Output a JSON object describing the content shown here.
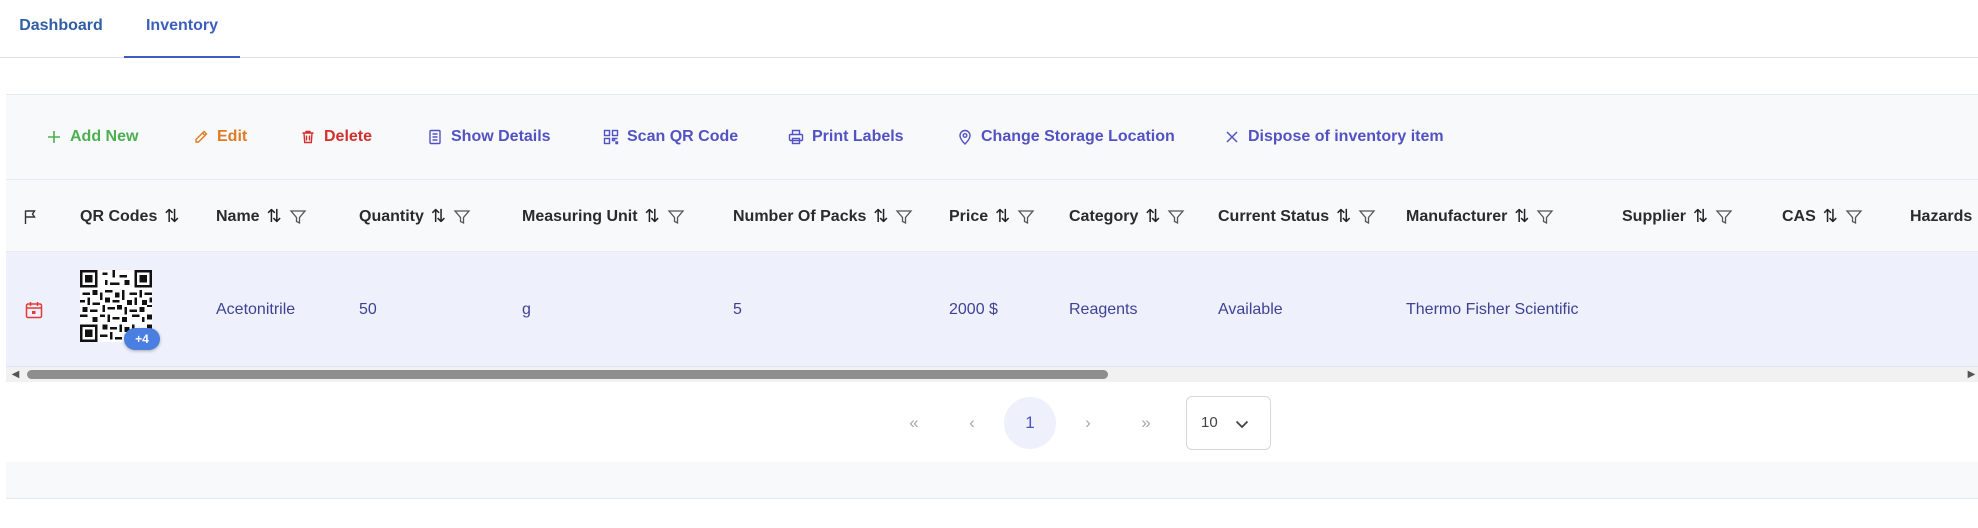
{
  "tabs": [
    {
      "label": "Dashboard"
    },
    {
      "label": "Inventory"
    }
  ],
  "toolbar": {
    "add_new": "Add New",
    "edit": "Edit",
    "delete": "Delete",
    "show_details": "Show Details",
    "scan_qr": "Scan QR Code",
    "print_labels": "Print Labels",
    "change_storage": "Change Storage Location",
    "dispose": "Dispose of inventory item"
  },
  "columns": {
    "qr_codes": "QR Codes",
    "name": "Name",
    "quantity": "Quantity",
    "measuring_unit": "Measuring Unit",
    "number_of_packs": "Number Of Packs",
    "price": "Price",
    "category": "Category",
    "current_status": "Current Status",
    "manufacturer": "Manufacturer",
    "supplier": "Supplier",
    "cas": "CAS",
    "hazards": "Hazards"
  },
  "sort_glyph": "⇅",
  "rows": [
    {
      "qr_extra": "+4",
      "name": "Acetonitrile",
      "quantity": "50",
      "measuring_unit": "g",
      "number_of_packs": "5",
      "price": "2000 $",
      "category": "Reagents",
      "current_status": "Available",
      "manufacturer": "Thermo Fisher Scientific",
      "supplier": "",
      "cas": "",
      "hazards": ""
    }
  ],
  "pagination": {
    "first": "«",
    "prev": "‹",
    "current_page": "1",
    "next": "›",
    "last": "»",
    "per_page": "10"
  },
  "colors": {
    "add": "#4caf50",
    "edit": "#e07a24",
    "delete": "#d32f2f",
    "action": "#5352c5",
    "row_highlight": "#eef0fc"
  }
}
